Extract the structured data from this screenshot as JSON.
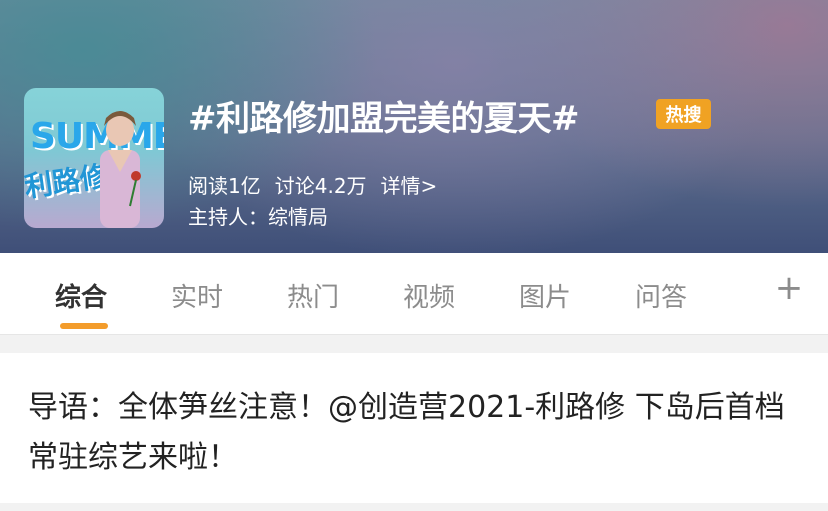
{
  "topic": {
    "title": "#利路修加盟完美的夏天#",
    "badge": "热搜",
    "reads": "阅读1亿",
    "discussions": "讨论4.2万",
    "details": "详情>",
    "host": "主持人：综情局",
    "cover": {
      "title_text": "SUMME",
      "name_text": "利路修"
    }
  },
  "tabs": [
    {
      "label": "综合"
    },
    {
      "label": "实时"
    },
    {
      "label": "热门"
    },
    {
      "label": "视频"
    },
    {
      "label": "图片"
    },
    {
      "label": "问答"
    }
  ],
  "tab_add_label": "+",
  "lead": {
    "text": "导语：全体笋丝注意！@创造营2021-利路修 下岛后首档常驻综艺来啦！"
  },
  "colors": {
    "accent": "#f39c2b",
    "badge": "#f0a223"
  }
}
